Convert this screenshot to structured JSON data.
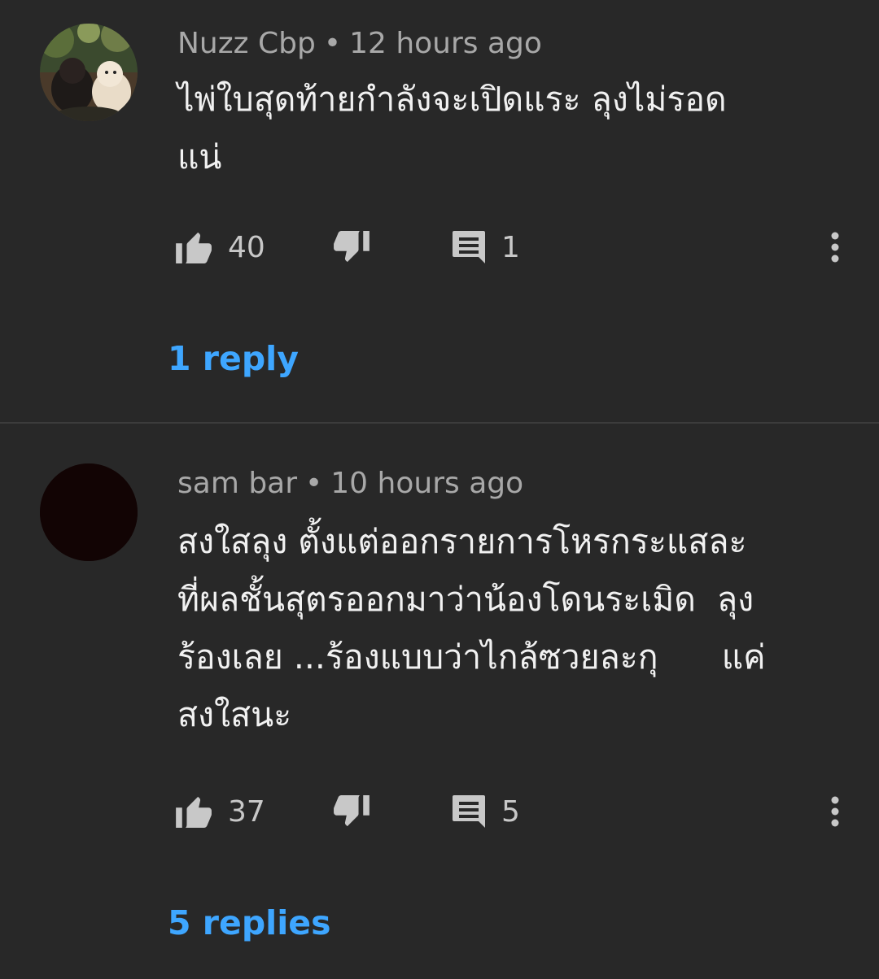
{
  "comments": [
    {
      "author": "Nuzz Cbp",
      "separator": "•",
      "time": "12 hours ago",
      "text": "ไพ่ใบสุดท้ายกำลังจะเปิดแระ ลุงไม่รอด\nแน่",
      "likes": "40",
      "reply_count": "1",
      "replies_label": "1 reply",
      "avatar_icon": "dog-photo-avatar"
    },
    {
      "author": "sam bar",
      "separator": "•",
      "time": "10 hours ago",
      "text": "สงใสลุง ตั้งแต่ออกรายการโหรกระแสละ\nที่ผลชั้นสุตรออกมาว่าน้องโดนระเมิด  ลุง\nร้องเลย ...ร้องแบบว่าไกล้ซวยละกุ      แค่\nสงใสนะ",
      "likes": "37",
      "reply_count": "5",
      "replies_label": "5 replies",
      "avatar_icon": "dark-avatar"
    }
  ],
  "colors": {
    "background": "#282828",
    "link": "#3ea6ff",
    "meta_text": "#a8a8a8",
    "body_text": "#f1f1f1"
  }
}
